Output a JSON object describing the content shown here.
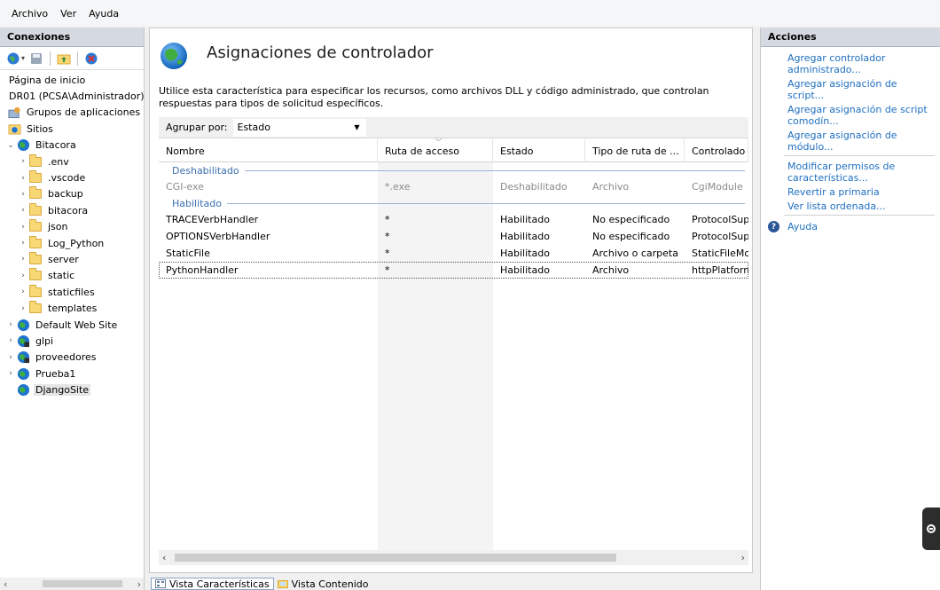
{
  "menu": [
    "Archivo",
    "Ver",
    "Ayuda"
  ],
  "connections": {
    "header": "Conexiones",
    "tree": [
      {
        "label": "Página de inicio",
        "level": 0,
        "icon": "none",
        "expander": ""
      },
      {
        "label": "DR01 (PCSA\\Administrador)",
        "level": 0,
        "icon": "none",
        "expander": ""
      },
      {
        "label": "Grupos de aplicaciones",
        "level": 0,
        "icon": "app-pool-icon",
        "expander": ""
      },
      {
        "label": "Sitios",
        "level": 0,
        "icon": "sites-icon",
        "expander": ""
      },
      {
        "label": "Bitacora",
        "level": 1,
        "icon": "globe-icon",
        "expander": "expanded"
      },
      {
        "label": ".env",
        "level": 2,
        "icon": "folder-icon",
        "expander": "collapsed"
      },
      {
        "label": ".vscode",
        "level": 2,
        "icon": "folder-icon",
        "expander": "collapsed"
      },
      {
        "label": "backup",
        "level": 2,
        "icon": "folder-icon",
        "expander": "collapsed"
      },
      {
        "label": "bitacora",
        "level": 2,
        "icon": "folder-icon",
        "expander": "collapsed"
      },
      {
        "label": "json",
        "level": 2,
        "icon": "folder-icon",
        "expander": "collapsed"
      },
      {
        "label": "Log_Python",
        "level": 2,
        "icon": "folder-icon",
        "expander": "collapsed"
      },
      {
        "label": "server",
        "level": 2,
        "icon": "folder-icon",
        "expander": "collapsed"
      },
      {
        "label": "static",
        "level": 2,
        "icon": "folder-icon",
        "expander": "collapsed"
      },
      {
        "label": "staticfiles",
        "level": 2,
        "icon": "folder-icon",
        "expander": "collapsed"
      },
      {
        "label": "templates",
        "level": 2,
        "icon": "folder-icon",
        "expander": "collapsed"
      },
      {
        "label": "Default Web Site",
        "level": 1,
        "icon": "globe-icon",
        "expander": "collapsed"
      },
      {
        "label": "glpi",
        "level": 1,
        "icon": "globe-stopped-icon",
        "expander": "collapsed"
      },
      {
        "label": "proveedores",
        "level": 1,
        "icon": "globe-stopped-icon",
        "expander": "collapsed"
      },
      {
        "label": "Prueba1",
        "level": 1,
        "icon": "globe-icon",
        "expander": "collapsed"
      },
      {
        "label": "DjangoSite",
        "level": 1,
        "icon": "globe-icon",
        "expander": "",
        "selected": true
      }
    ]
  },
  "main": {
    "title": "Asignaciones de controlador",
    "description": "Utilice esta característica para especificar los recursos, como archivos DLL y código administrado, que controlan respuestas para tipos de solicitud específicos.",
    "group_by_label": "Agrupar por:",
    "group_by_value": "Estado",
    "columns": [
      "Nombre",
      "Ruta de acceso",
      "Estado",
      "Tipo de ruta de ...",
      "Controlado"
    ],
    "groups": [
      {
        "name": "Deshabilitado",
        "rows": [
          {
            "cells": [
              "CGI-exe",
              "*.exe",
              "Deshabilitado",
              "Archivo",
              "CgiModule"
            ],
            "disabled": true
          }
        ]
      },
      {
        "name": "Habilitado",
        "rows": [
          {
            "cells": [
              "TRACEVerbHandler",
              "*",
              "Habilitado",
              "No especificado",
              "ProtocolSup"
            ]
          },
          {
            "cells": [
              "OPTIONSVerbHandler",
              "*",
              "Habilitado",
              "No especificado",
              "ProtocolSup"
            ]
          },
          {
            "cells": [
              "StaticFile",
              "*",
              "Habilitado",
              "Archivo o carpeta",
              "StaticFileMo"
            ]
          },
          {
            "cells": [
              "PythonHandler",
              "*",
              "Habilitado",
              "Archivo",
              "httpPlatform"
            ],
            "focused": true
          }
        ]
      }
    ],
    "tabs": [
      "Vista Características",
      "Vista Contenido"
    ]
  },
  "actions": {
    "header": "Acciones",
    "links": [
      "Agregar controlador administrado...",
      "Agregar asignación de script...",
      "Agregar asignación de script comodín...",
      "Agregar asignación de módulo..."
    ],
    "links2": [
      "Modificar permisos de características...",
      "Revertir a primaria",
      "Ver lista ordenada..."
    ],
    "help": "Ayuda"
  },
  "colors": {
    "link": "#1f6fc0",
    "panel_header": "#d5d9e1",
    "group_text": "#3a6fb0",
    "folder": "#f8d775"
  }
}
